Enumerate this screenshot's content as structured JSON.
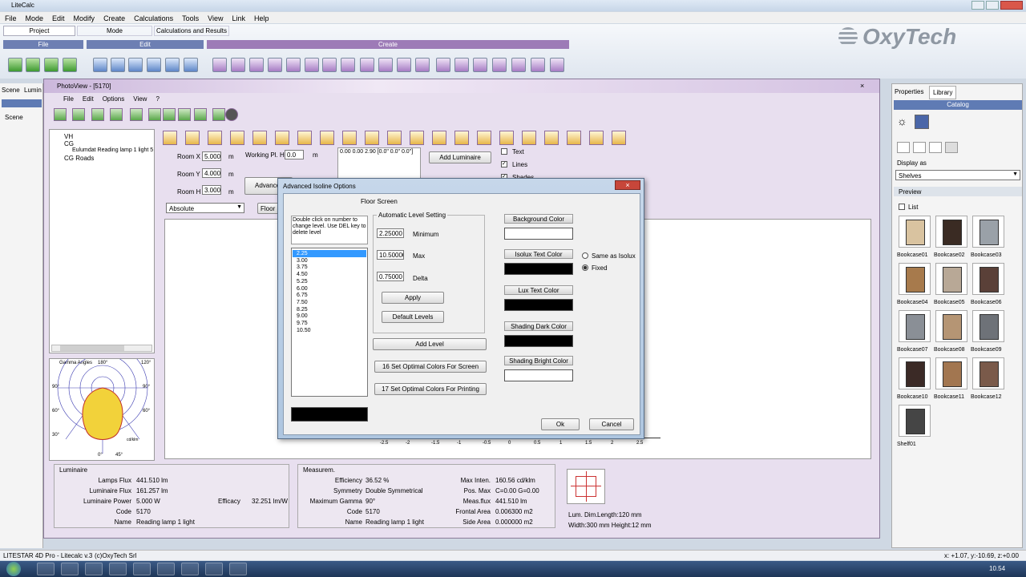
{
  "app": {
    "title": "LiteCalc",
    "watermark": "OxyTech",
    "status_left": "LITESTAR 4D Pro - Litecalc v.3",
    "status_mid": "(c)OxyTech Srl",
    "status_right": "x: +1.07, y:-10.69, z:+0.00"
  },
  "menu": [
    "File",
    "Mode",
    "Edit",
    "Modify",
    "Create",
    "Calculations",
    "Tools",
    "View",
    "Link",
    "Help"
  ],
  "ribbon": {
    "tabs": [
      "Project",
      "Mode",
      "Calculations and Results"
    ],
    "groups": [
      "File",
      "Edit",
      "Create"
    ]
  },
  "left_tabs": [
    "Scene",
    "Lumin"
  ],
  "left_tree": [
    "Scene"
  ],
  "photoview": {
    "title": "PhotoView - [5170]",
    "menu": [
      "File",
      "Edit",
      "Options",
      "View",
      "?"
    ],
    "tree": [
      "VH",
      "CG",
      "Eulumdat Reading lamp 1 light 5",
      "CG Roads"
    ],
    "room_x_label": "Room X",
    "room_x": "5.000",
    "room_y_label": "Room Y",
    "room_y": "4.000",
    "room_h_label": "Room H",
    "room_h": "3.000",
    "unit": "m",
    "working_label": "Working Pl. H",
    "working_val": "0.0",
    "coords": "0.00 0.00 2.90 [0.0\" 0.0\" 0.0\"]",
    "add_luminaire": "Add Luminaire",
    "advanced_btn": "Advance",
    "floor_btn": "Floor",
    "absolute": "Absolute",
    "chk_text": "Text",
    "chk_lines": "Lines",
    "chk_shades": "Shades",
    "polar_title": "Gamma Angles",
    "polar_180": "180°",
    "polar_120": "120°",
    "polar_90l": "90°",
    "polar_90r": "90°",
    "polar_60l": "60°",
    "polar_60r": "60°",
    "polar_30l": "30°",
    "polar_0": "0°",
    "polar_15": "45°",
    "polar_unit": "cd/klm",
    "luminaire": {
      "heading": "Luminaire",
      "rows": [
        [
          "Lamps Flux",
          "441.510 lm"
        ],
        [
          "Luminaire Flux",
          "161.257 lm"
        ],
        [
          "Luminaire Power",
          "5.000 W"
        ],
        [
          "Code",
          "5170"
        ],
        [
          "Name",
          "Reading lamp 1 light"
        ]
      ],
      "eff_label": "Efficacy",
      "eff_val": "32.251 lm/W"
    },
    "measure": {
      "heading": "Measurem.",
      "rows": [
        [
          "Efficiency",
          "36.52 %"
        ],
        [
          "Symmetry",
          "Double Symmetrical"
        ],
        [
          "Maximum Gamma",
          "90°"
        ],
        [
          "Code",
          "5170"
        ],
        [
          "Name",
          "Reading lamp 1 light"
        ]
      ],
      "rows2": [
        [
          "Max Inten.",
          "160.56 cd/klm"
        ],
        [
          "Pos. Max",
          "C=0.00 G=0.00"
        ],
        [
          "Meas.flux",
          "441.510 lm"
        ],
        [
          "Frontal Area",
          "0.006300 m2"
        ],
        [
          "Side Area",
          "0.000000 m2"
        ]
      ]
    },
    "dims": {
      "lum_dim": "Lum. Dim.",
      "length": "Length:120 mm",
      "width": "Width:300 mm Height:12 mm"
    },
    "axis": [
      "-2.5",
      "-2",
      "-1.5",
      "-1",
      "-0.5",
      "0",
      "0.5",
      "1",
      "1.5",
      "2",
      "2.5"
    ]
  },
  "dialog": {
    "title": "Advanced Isoline Options",
    "subtitle": "Floor Screen",
    "hint": "Double click on number to change level. Use DEL key to delete level",
    "levels": [
      "2.25",
      "3.00",
      "3.75",
      "4.50",
      "5.25",
      "6.00",
      "6.75",
      "7.50",
      "8.25",
      "9.00",
      "9.75",
      "10.50"
    ],
    "auto_heading": "Automatic Level Setting",
    "min_val": "2.25000",
    "min_label": "Minimum",
    "max_val": "10.50000",
    "max_label": "Max",
    "delta_val": "0.75000",
    "delta_label": "Delta",
    "apply": "Apply",
    "default_levels": "Default Levels",
    "add_level": "Add Level",
    "screen_colors": "16 Set Optimal Colors For Screen",
    "print_colors": "17 Set Optimal Colors For Printing",
    "bg_color": "Background Color",
    "isolux_text": "Isolux Text Color",
    "lux_text": "Lux Text Color",
    "shade_dark": "Shading Dark Color",
    "shade_bright": "Shading Bright Color",
    "same_as": "Same as Isolux",
    "fixed": "Fixed",
    "ok": "Ok",
    "cancel": "Cancel"
  },
  "right": {
    "tabs": [
      "Properties",
      "Library"
    ],
    "catalog": "Catalog",
    "display_as": "Display as",
    "shelves": "Shelves",
    "preview": "Preview",
    "list": "List",
    "items": [
      "Bookcase01",
      "Bookcase02",
      "Bookcase03",
      "Bookcase04",
      "Bookcase05",
      "Bookcase06",
      "Bookcase07",
      "Bookcase08",
      "Bookcase09",
      "Bookcase10",
      "Bookcase11",
      "Bookcase12",
      "Shelf01"
    ]
  },
  "taskbar": {
    "clock": "10.54"
  }
}
